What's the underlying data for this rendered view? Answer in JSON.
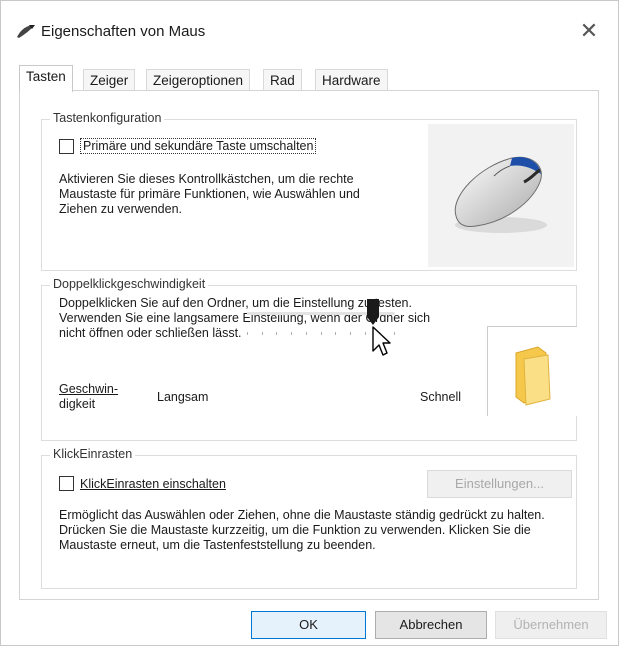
{
  "window": {
    "title": "Eigenschaften von Maus",
    "close_glyph": "✕",
    "icon": "mouse-pointer-icon"
  },
  "tabs": [
    {
      "label": "Tasten",
      "active": true
    },
    {
      "label": "Zeiger",
      "active": false
    },
    {
      "label": "Zeigeroptionen",
      "active": false
    },
    {
      "label": "Rad",
      "active": false
    },
    {
      "label": "Hardware",
      "active": false
    }
  ],
  "button_config": {
    "group_label": "Tastenkonfiguration",
    "checkbox_label": "Primäre und sekundäre Taste umschalten",
    "checkbox_checked": false,
    "description": "Aktivieren Sie dieses Kontrollkästchen, um die rechte Maustaste für primäre Funktionen, wie Auswählen und Ziehen zu verwenden.",
    "illustration_icon": "mouse-icon"
  },
  "double_click": {
    "group_label": "Doppelklickgeschwindigkeit",
    "description": "Doppelklicken Sie auf den Ordner, um die Einstellung zu testen. Verwenden Sie eine langsamere Einstellung, wenn der Ordner sich nicht öffnen oder schließen lässt.",
    "speed_label_line1": "Geschwin-",
    "speed_label_line2": "digkeit",
    "slow_label": "Langsam",
    "fast_label": "Schnell",
    "slider_value_fraction": 0.85,
    "folder_icon": "folder-icon"
  },
  "click_lock": {
    "group_label": "KlickEinrasten",
    "checkbox_label": "KlickEinrasten einschalten",
    "checkbox_checked": false,
    "settings_button": "Einstellungen...",
    "description": "Ermöglicht das Auswählen oder Ziehen, ohne die Maustaste ständig gedrückt zu halten. Drücken Sie die Maustaste kurzzeitig, um die Funktion zu verwenden. Klicken Sie die Maustaste erneut, um die Tastenfeststellung zu beenden."
  },
  "footer": {
    "ok": "OK",
    "cancel": "Abbrechen",
    "apply": "Übernehmen"
  },
  "colors": {
    "accent": "#0078d7",
    "folder": "#f5c84c"
  }
}
